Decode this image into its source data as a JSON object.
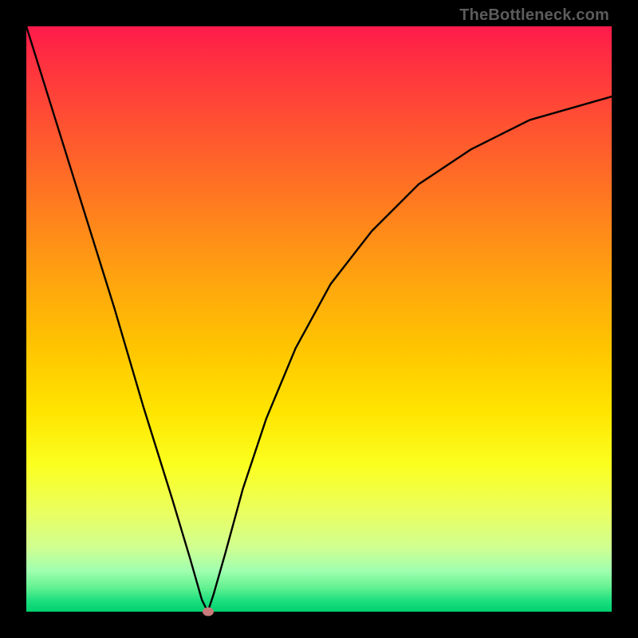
{
  "branding": {
    "watermark": "TheBottleneck.com"
  },
  "chart_data": {
    "type": "line",
    "title": "",
    "xlabel": "",
    "ylabel": "",
    "xlim": [
      0,
      100
    ],
    "ylim": [
      0,
      100
    ],
    "grid": false,
    "legend": false,
    "annotations": [],
    "background_gradient": {
      "direction": "vertical",
      "stops": [
        {
          "pos": 0,
          "color": "#ff1a4b"
        },
        {
          "pos": 50,
          "color": "#ffc500"
        },
        {
          "pos": 80,
          "color": "#fbff20"
        },
        {
          "pos": 100,
          "color": "#00d070"
        }
      ]
    },
    "series": [
      {
        "name": "left-branch",
        "x": [
          0,
          5,
          10,
          15,
          20,
          25,
          28,
          30,
          31
        ],
        "values": [
          100,
          84,
          68,
          52,
          35,
          19,
          9,
          2,
          0
        ]
      },
      {
        "name": "right-branch",
        "x": [
          31,
          32,
          34,
          37,
          41,
          46,
          52,
          59,
          67,
          76,
          86,
          100
        ],
        "values": [
          0,
          3,
          10,
          21,
          33,
          45,
          56,
          65,
          73,
          79,
          84,
          88
        ]
      }
    ],
    "marker": {
      "x": 31,
      "y": 0,
      "color": "#c97a7a"
    }
  },
  "colors": {
    "curve": "#000000",
    "frame": "#000000",
    "marker": "#c97a7a"
  }
}
